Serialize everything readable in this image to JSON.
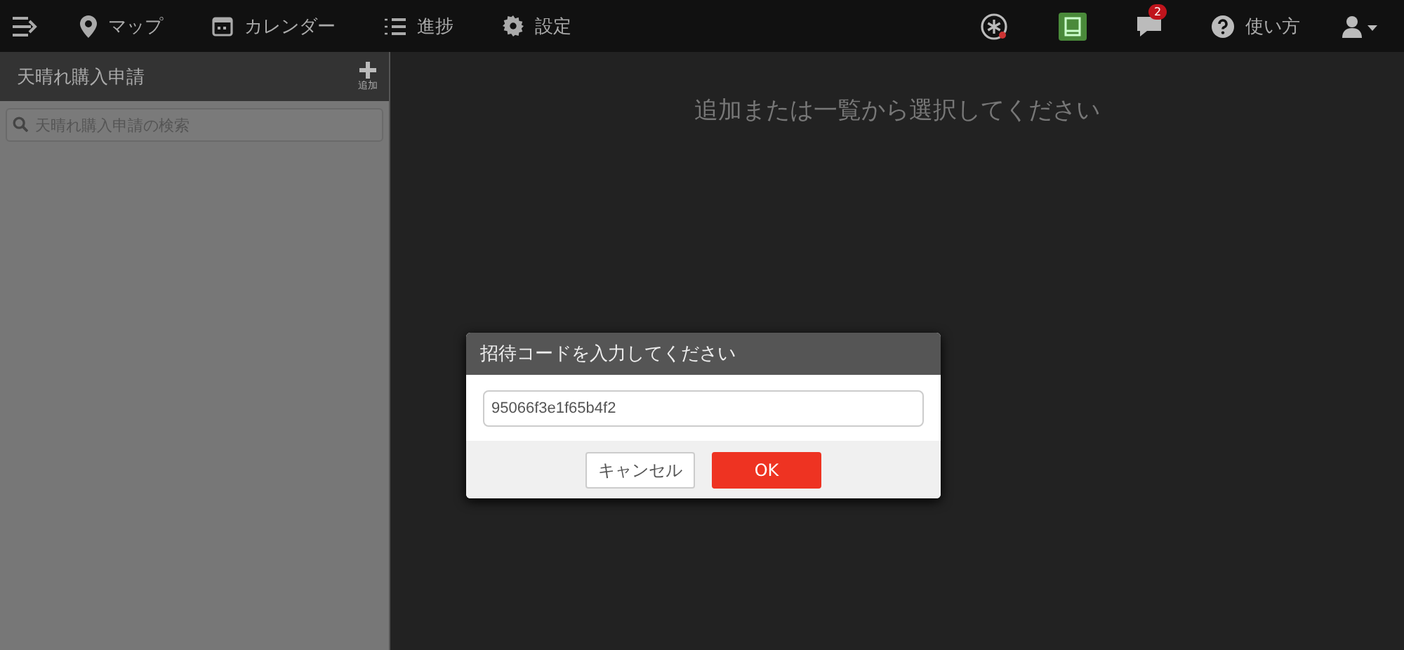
{
  "nav": {
    "items": [
      {
        "kind": "map",
        "label": "マップ"
      },
      {
        "kind": "calendar",
        "label": "カレンダー"
      },
      {
        "kind": "progress",
        "label": "進捗"
      },
      {
        "kind": "settings",
        "label": "設定"
      }
    ],
    "notifications": {
      "count": "2"
    },
    "help": {
      "label": "使い方"
    }
  },
  "sidebar": {
    "title": "天晴れ購入申請",
    "add_label": "追加",
    "search": {
      "placeholder": "天晴れ購入申請の検索"
    }
  },
  "main": {
    "message": "追加または一覧から選択してください"
  },
  "dialog": {
    "title": "招待コードを入力してください",
    "value": "95066f3e1f65b4f2",
    "buttons": [
      {
        "kind": "cancel",
        "label": "キャンセル"
      },
      {
        "kind": "ok",
        "label": "OK"
      }
    ]
  }
}
